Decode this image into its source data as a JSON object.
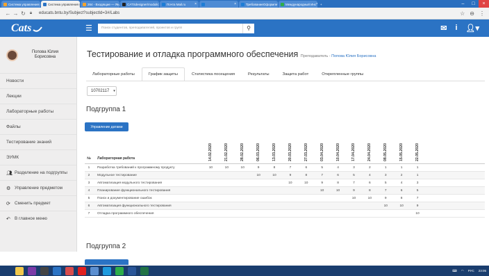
{
  "browser": {
    "tabs": [
      {
        "label": "Система управления у",
        "fav": "#f2a32c",
        "active": false
      },
      {
        "label": "Система управления у",
        "fav": "#2b73c4",
        "active": true
      },
      {
        "label": "264 - Входящие — Янд",
        "fav": "#f2a32c",
        "active": false
      },
      {
        "label": "CATSdesigner/modulic",
        "fav": "#222222",
        "active": false
      },
      {
        "label": "Почта Mail.ru",
        "fav": "#1d7dd6",
        "active": false
      },
      {
        "label": "",
        "fav": "#1d7dd6",
        "active": false
      },
      {
        "label": "ТребованиеОформле",
        "fav": "#1d7dd6",
        "active": false
      },
      {
        "label": "Международный Инс",
        "fav": "#2eae4a",
        "active": false
      }
    ],
    "url": "educats.bntu.by/Subject?subjectId=3#/Labs"
  },
  "app": {
    "logo": "Cats",
    "search_placeholder": "Поиск студентов, преподавателей, проектов и групп"
  },
  "sidebar": {
    "user": "Попова Юлия Борисовна",
    "items": [
      {
        "label": "Новости",
        "icon": ""
      },
      {
        "label": "Лекции",
        "icon": ""
      },
      {
        "label": "Лабораторные работы",
        "icon": ""
      },
      {
        "label": "Файлы",
        "icon": ""
      },
      {
        "label": "Тестирование знаний",
        "icon": ""
      },
      {
        "label": "ЭУМК",
        "icon": ""
      },
      {
        "label": "Разделение на подгруппы",
        "icon": "users-icon"
      },
      {
        "label": "Управление предметом",
        "icon": "gear-icon"
      },
      {
        "label": "Сменить предмет",
        "icon": "refresh-icon"
      },
      {
        "label": "В главное меню",
        "icon": "reply-icon"
      }
    ]
  },
  "page": {
    "title": "Тестирование и отладка программного обеспечения",
    "teacher_prefix": "Преподаватель - ",
    "teacher": "Попова Юлия Борисовна",
    "tabs": [
      "Лабораторные работы",
      "График защиты",
      "Статистика посещения",
      "Результаты",
      "Защита работ",
      "Открепленные группы"
    ],
    "group": "10702117",
    "subgroup1": "Подгруппа 1",
    "subgroup2": "Подгруппа 2",
    "dates_button": "Управление датами"
  },
  "table": {
    "col_num": "№",
    "col_work": "Лабораторная работа",
    "dates": [
      "14.02.2020",
      "21.02.2020",
      "28.02.2020",
      "06.03.2020",
      "13.03.2020",
      "20.03.2020",
      "27.03.2020",
      "03.04.2020",
      "10.04.2020",
      "17.04.2020",
      "24.04.2020",
      "08.05.2020",
      "15.05.2020",
      "22.05.2020"
    ],
    "rows": [
      {
        "n": "1",
        "name": "Разработка требований к программному продукту",
        "vals": [
          "10",
          "10",
          "10",
          "9",
          "8",
          "7",
          "6",
          "5",
          "4",
          "3",
          "2",
          "1",
          "1",
          "1"
        ]
      },
      {
        "n": "2",
        "name": "Модульное тестирование",
        "vals": [
          "",
          "",
          "",
          "10",
          "10",
          "9",
          "8",
          "7",
          "6",
          "5",
          "4",
          "3",
          "2",
          "1"
        ]
      },
      {
        "n": "3",
        "name": "Автоматизация модульного тестирования",
        "vals": [
          "",
          "",
          "",
          "",
          "",
          "10",
          "10",
          "9",
          "8",
          "7",
          "6",
          "5",
          "4",
          "3"
        ]
      },
      {
        "n": "4",
        "name": "Планирование функционального тестирования",
        "vals": [
          "",
          "",
          "",
          "",
          "",
          "",
          "",
          "10",
          "10",
          "9",
          "8",
          "7",
          "6",
          "5"
        ]
      },
      {
        "n": "5",
        "name": "Поиск и документирование ошибок",
        "vals": [
          "",
          "",
          "",
          "",
          "",
          "",
          "",
          "",
          "",
          "10",
          "10",
          "9",
          "8",
          "7"
        ]
      },
      {
        "n": "6",
        "name": "Автоматизация функционального тестирования",
        "vals": [
          "",
          "",
          "",
          "",
          "",
          "",
          "",
          "",
          "",
          "",
          "",
          "10",
          "10",
          "9"
        ]
      },
      {
        "n": "7",
        "name": "Отладка программного обеспечения",
        "vals": [
          "",
          "",
          "",
          "",
          "",
          "",
          "",
          "",
          "",
          "",
          "",
          "",
          "",
          "10"
        ]
      }
    ]
  },
  "taskbar": {
    "icons": [
      {
        "name": "start-icon",
        "color": "#1a3d6e"
      },
      {
        "name": "explorer-icon",
        "color": "#f2c94c"
      },
      {
        "name": "onenote-icon",
        "color": "#7a3aa8"
      },
      {
        "name": "calculator-icon",
        "color": "#444444"
      },
      {
        "name": "person-icon",
        "color": "#2b73c4"
      },
      {
        "name": "paint-icon",
        "color": "#d94c4c"
      },
      {
        "name": "yandex-icon",
        "color": "#e02020"
      },
      {
        "name": "printer-icon",
        "color": "#5b8fd1"
      },
      {
        "name": "skype-icon",
        "color": "#1e9ade"
      },
      {
        "name": "chrome-icon",
        "color": "#2eae4a"
      },
      {
        "name": "word-icon",
        "color": "#2a5699"
      },
      {
        "name": "excel-icon",
        "color": "#207245"
      }
    ],
    "lang": "РУС",
    "time": "23:05"
  }
}
